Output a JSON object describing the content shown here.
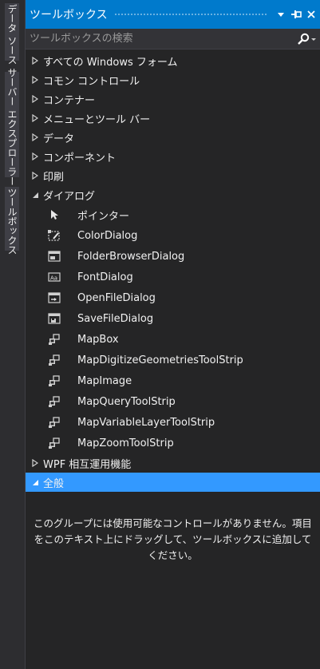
{
  "side_tabs": [
    "データ ソース",
    "サーバー エクスプローラー",
    "ツールボックス"
  ],
  "title": "ツールボックス",
  "title_buttons": {
    "dropdown": "▾",
    "pin": "⊣",
    "close": "✕"
  },
  "search": {
    "placeholder": "ツールボックスの検索",
    "value": ""
  },
  "categories_top": [
    {
      "label": "すべての Windows フォーム",
      "expanded": false
    },
    {
      "label": "コモン コントロール",
      "expanded": false
    },
    {
      "label": "コンテナー",
      "expanded": false
    },
    {
      "label": "メニューとツール バー",
      "expanded": false
    },
    {
      "label": "データ",
      "expanded": false
    },
    {
      "label": "コンポーネント",
      "expanded": false
    },
    {
      "label": "印刷",
      "expanded": false
    }
  ],
  "dialog_category": {
    "label": "ダイアログ",
    "expanded": true,
    "items": [
      {
        "label": "ポインター",
        "icon": "pointer-icon"
      },
      {
        "label": "ColorDialog",
        "icon": "color-dialog-icon"
      },
      {
        "label": "FolderBrowserDialog",
        "icon": "folder-browser-dialog-icon"
      },
      {
        "label": "FontDialog",
        "icon": "font-dialog-icon"
      },
      {
        "label": "OpenFileDialog",
        "icon": "open-file-dialog-icon"
      },
      {
        "label": "SaveFileDialog",
        "icon": "save-file-dialog-icon"
      },
      {
        "label": "MapBox",
        "icon": "component-icon"
      },
      {
        "label": "MapDigitizeGeometriesToolStrip",
        "icon": "component-icon"
      },
      {
        "label": "MapImage",
        "icon": "component-icon"
      },
      {
        "label": "MapQueryToolStrip",
        "icon": "component-icon"
      },
      {
        "label": "MapVariableLayerToolStrip",
        "icon": "component-icon"
      },
      {
        "label": "MapZoomToolStrip",
        "icon": "component-icon"
      }
    ]
  },
  "wpf_category": {
    "label": "WPF 相互運用機能",
    "expanded": false
  },
  "general_category": {
    "label": "全般",
    "expanded": true,
    "selected": true
  },
  "empty_message": "このグループには使用可能なコントロールがありません。項目をこのテキスト上にドラッグして、ツールボックスに追加してください。",
  "colors": {
    "accent": "#007acc",
    "selection": "#3399ff",
    "panel_bg": "#252526",
    "chrome_bg": "#2d2d30",
    "text": "#f1f1f1"
  }
}
